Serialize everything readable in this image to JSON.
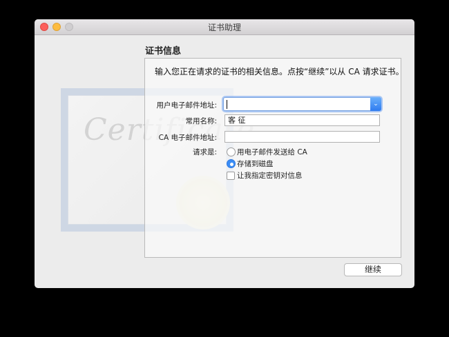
{
  "window": {
    "title": "证书助理"
  },
  "section_title": "证书信息",
  "intro_text": "输入您正在请求的证书的相关信息。点按“继续”以从 CA 请求证书。",
  "background_art": {
    "word": "Certificate"
  },
  "form": {
    "email": {
      "label": "用户电子邮件地址:",
      "value": ""
    },
    "common_name": {
      "label": "常用名称:",
      "value": "客 征"
    },
    "ca_email": {
      "label": "CA 电子邮件地址:",
      "value": ""
    },
    "request": {
      "label": "请求是:",
      "options": [
        {
          "label": "用电子邮件发送给 CA",
          "selected": false
        },
        {
          "label": "存储到磁盘",
          "selected": true
        }
      ]
    },
    "specify_key": {
      "label": "让我指定密钥对信息",
      "checked": false
    }
  },
  "buttons": {
    "continue": "继续"
  },
  "colors": {
    "accent": "#3b8df5",
    "close": "#fc605c",
    "minimize": "#fdbc40"
  }
}
